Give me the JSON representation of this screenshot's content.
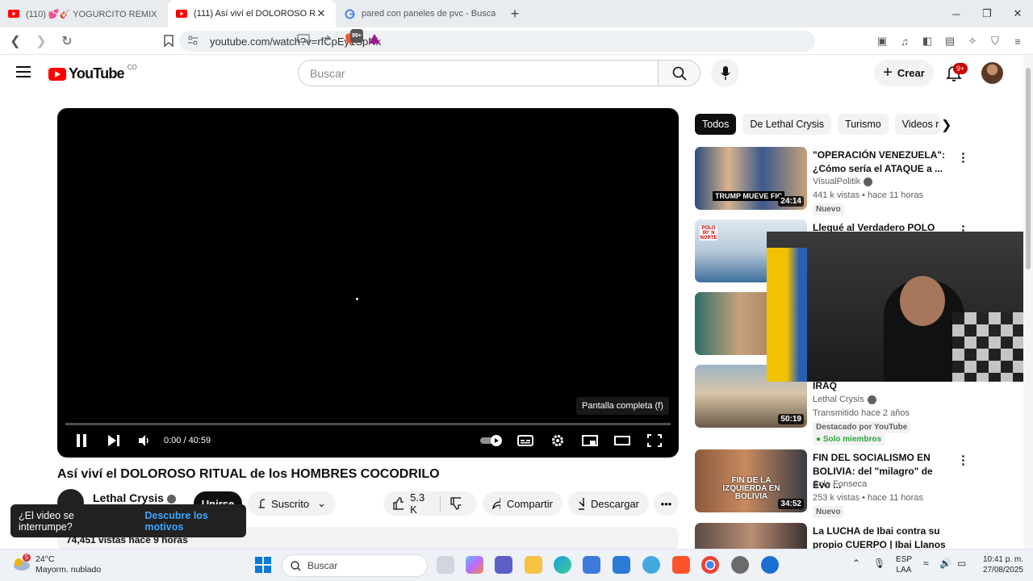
{
  "browser": {
    "tabs": [
      {
        "title": "(110) 💕🎸 YOGURCITO REMIX | BL",
        "active": false
      },
      {
        "title": "(111) Así viví el DOLOROSO RITU",
        "active": true
      },
      {
        "title": "pared con paneles de pvc - Buscar co",
        "active": false
      }
    ],
    "url": "youtube.com/watch?v=rfCpEy1SpNk",
    "ext_badge": "99+"
  },
  "yt": {
    "logo_text": "YouTube",
    "logo_country": "CO",
    "search_placeholder": "Buscar",
    "create_label": "Crear",
    "notif_count": "9+"
  },
  "player": {
    "time": "0:00 / 40:59",
    "tooltip": "Pantalla completa (f)",
    "progress": 0
  },
  "video": {
    "title": "Así viví el DOLOROSO RITUAL de los HOMBRES COCODRILO",
    "channel": "Lethal Crysis",
    "join_label": "Unirse",
    "subscribed_label": "Suscrito",
    "likes": "5.3 K",
    "share_label": "Compartir",
    "download_label": "Descargar",
    "views_line": "74,451 vistas  hace 9 horas"
  },
  "toast": {
    "text": "¿El video se interrumpe?",
    "link": "Descubre los motivos"
  },
  "chips": [
    "Todos",
    "De Lethal Crysis",
    "Turismo",
    "Videos r"
  ],
  "recs": [
    {
      "title": "\"OPERACIÓN VENEZUELA\": ¿Cómo sería el ATAQUE a ...",
      "channel": "VisualPolitik",
      "meta": "441 k vistas • hace 11 horas",
      "tag": "Nuevo",
      "duration": "24:14",
      "thumb_text": "TRUMP MUEVE FIC"
    },
    {
      "title": "Llegué al Verdadero POLO",
      "channel": "",
      "meta": "",
      "tag": "",
      "duration": "",
      "thumb_text": "POLO 90° N NORTE"
    },
    {
      "title": "",
      "channel": "",
      "meta": "",
      "tag": "",
      "duration": "",
      "thumb_text": ""
    },
    {
      "title": "IRAQ",
      "channel": "Lethal Crysis",
      "meta": "Transmitido hace 2 años",
      "tag": "Destacado por YouTube",
      "tag2": "Solo miembros",
      "duration": "50:19",
      "thumb_text": ""
    },
    {
      "title": "FIN DEL SOCIALISMO EN BOLIVIA: del \"milagro\" de Evo ...",
      "channel": "Solo Fonseca",
      "meta": "253 k vistas • hace 11 horas",
      "tag": "Nuevo",
      "duration": "34:52",
      "thumb_text": "FIN DE LA IZQUIERDA EN BOLIVIA"
    },
    {
      "title": "La LUCHA de Ibai contra su propio CUERPO | Ibai Llanos | ...",
      "channel": "",
      "meta": "",
      "tag": "",
      "duration": "",
      "thumb_text": ""
    }
  ],
  "taskbar": {
    "temp": "24°C",
    "weather": "Mayorm. nublado",
    "weather_badge": "5",
    "search": "Buscar",
    "lang1": "ESP",
    "lang2": "LAA",
    "time": "10:41 p. m.",
    "date": "27/08/2025"
  }
}
